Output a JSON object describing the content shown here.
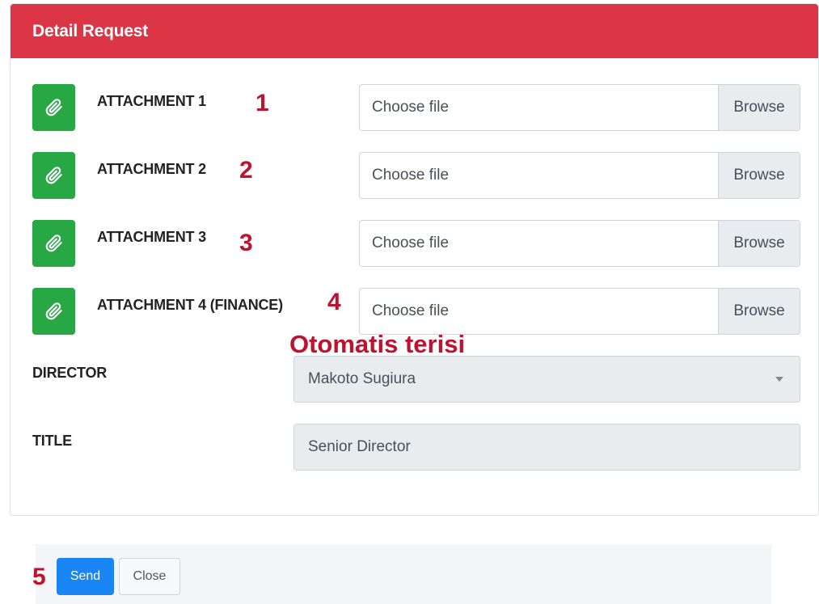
{
  "header": {
    "title": "Detail Request"
  },
  "attachments": [
    {
      "label": "ATTACHMENT 1",
      "annotation": "1",
      "placeholder": "Choose file",
      "browse": "Browse"
    },
    {
      "label": "ATTACHMENT 2",
      "annotation": "2",
      "placeholder": "Choose file",
      "browse": "Browse"
    },
    {
      "label": "ATTACHMENT 3",
      "annotation": "3",
      "placeholder": "Choose file",
      "browse": "Browse"
    },
    {
      "label": "ATTACHMENT 4 (FINANCE)",
      "annotation": "4",
      "placeholder": "Choose file",
      "browse": "Browse"
    }
  ],
  "auto_fill_note": "Otomatis terisi",
  "director": {
    "label": "DIRECTOR",
    "value": "Makoto Sugiura"
  },
  "title_field": {
    "label": "TITLE",
    "value": "Senior Director"
  },
  "footer": {
    "annotation": "5",
    "send_label": "Send",
    "close_label": "Close"
  },
  "icons": {
    "attachment": "paperclip-icon",
    "select": "caret-down-icon"
  },
  "colors": {
    "header": "#dc3545",
    "attach_button": "#28a745",
    "primary": "#1a85f5",
    "annotation": "#c0122f"
  }
}
